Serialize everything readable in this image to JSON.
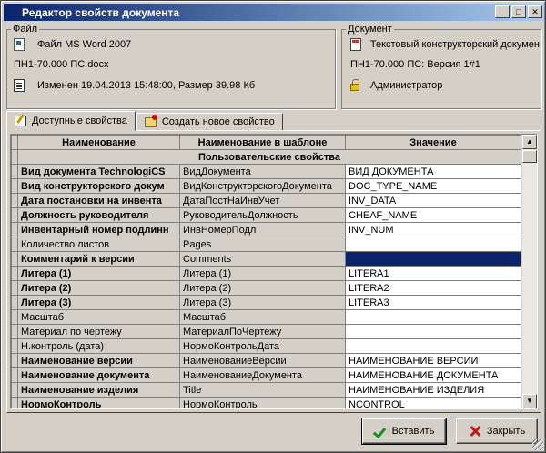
{
  "window": {
    "title": "Редактор свойств документа"
  },
  "file_group": {
    "legend": "Файл",
    "type": "Файл MS Word 2007",
    "name": "ПН1-70.000 ПС.docx",
    "modified": "Изменен 19.04.2013 15:48:00, Размер 39.98 Кб"
  },
  "doc_group": {
    "legend": "Документ",
    "type": "Текстовый конструкторский докумен",
    "name": "ПН1-70.000 ПС: Версия 1#1",
    "user": "Администратор"
  },
  "tabs": [
    {
      "label": "Доступные свойства",
      "active": true
    },
    {
      "label": "Создать новое свойство",
      "active": false
    }
  ],
  "grid": {
    "headers": [
      "Наименование",
      "Наименование в шаблоне",
      "Значение"
    ],
    "group_label": "Пользовательские свойства",
    "rows": [
      {
        "name": "Вид документа TechnologiCS",
        "template": "ВидДокумента",
        "value": "ВИД ДОКУМЕНТА",
        "bold": true
      },
      {
        "name": "Вид конструкторского докум",
        "template": "ВидКонструкторскогоДокумента",
        "value": "DOC_TYPE_NAME",
        "bold": true
      },
      {
        "name": "Дата постановки на инвента",
        "template": "ДатаПостНаИнвУчет",
        "value": "INV_DATA",
        "bold": true
      },
      {
        "name": "Должность руководителя",
        "template": "РуководительДолжность",
        "value": "CHEAF_NAME",
        "bold": true
      },
      {
        "name": "Инвентарный номер подлинн",
        "template": "ИнвНомерПодл",
        "value": "INV_NUM",
        "bold": true
      },
      {
        "name": "Количество листов",
        "template": "Pages",
        "value": "",
        "bold": false
      },
      {
        "name": "Комментарий к версии",
        "template": "Comments",
        "value": "",
        "bold": true,
        "selected": true
      },
      {
        "name": "Литера (1)",
        "template": "Литера (1)",
        "value": "LITERA1",
        "bold": true
      },
      {
        "name": "Литера (2)",
        "template": "Литера (2)",
        "value": "LITERA2",
        "bold": true
      },
      {
        "name": "Литера (3)",
        "template": "Литера (3)",
        "value": "LITERA3",
        "bold": true
      },
      {
        "name": "Масштаб",
        "template": "Масштаб",
        "value": "",
        "bold": false
      },
      {
        "name": "Материал по чертежу",
        "template": "МатериалПоЧертежу",
        "value": "",
        "bold": false
      },
      {
        "name": "Н.контроль (дата)",
        "template": "НормоКонтрольДата",
        "value": "",
        "bold": false
      },
      {
        "name": "Наименование версии",
        "template": "НаименованиеВерсии",
        "value": "НАИМЕНОВАНИЕ ВЕРСИИ",
        "bold": true
      },
      {
        "name": "Наименование документа",
        "template": "НаименованиеДокумента",
        "value": "НАИМЕНОВАНИЕ ДОКУМЕНТА",
        "bold": true
      },
      {
        "name": "Наименование изделия",
        "template": "Title",
        "value": "НАИМЕНОВАНИЕ ИЗДЕЛИЯ",
        "bold": true
      },
      {
        "name": "НормоКонтроль",
        "template": "НормоКонтроль",
        "value": "NCONTROL",
        "bold": true
      }
    ]
  },
  "buttons": {
    "insert": "Вставить",
    "close": "Закрыть"
  },
  "icons": {
    "word": "word-doc-icon",
    "page": "page-icon",
    "pdf": "pdf-doc-icon",
    "lock": "lock-icon",
    "tab1": "edit-properties-icon",
    "tab2": "new-property-icon",
    "ok": "checkmark-icon",
    "cancel": "close-x-icon"
  }
}
